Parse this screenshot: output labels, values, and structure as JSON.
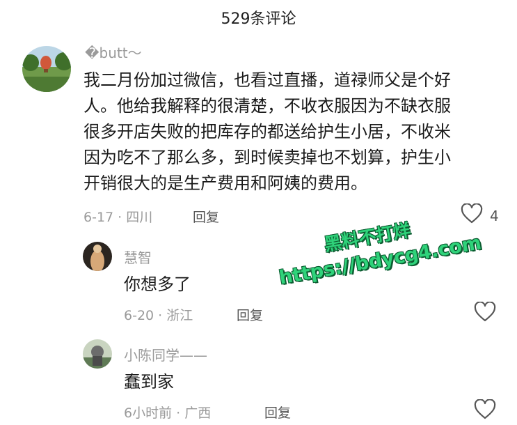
{
  "header": {
    "title": "529条评论"
  },
  "comments": [
    {
      "username": "�butt～",
      "lines": [
        "我二月份加过微信，也看过直播，道禄师父是个好",
        "人。他给我解释的很清楚，不收衣服因为不缺衣服",
        "很多开店失败的把库存的都送给护生小居，不收米",
        "因为吃不了那么多，到时候卖掉也不划算，护生小",
        "开销很大的是生产费用和阿姨的费用。"
      ],
      "meta": "6-17 · 四川",
      "reply_label": "回复",
      "likes": "4"
    }
  ],
  "replies": [
    {
      "username": "慧智",
      "text": "你想多了",
      "meta": "6-20 · 浙江",
      "reply_label": "回复"
    },
    {
      "username": "小陈同学——",
      "text": "蠢到家",
      "meta": "6小时前 · 广西",
      "reply_label": "回复"
    }
  ],
  "watermark": {
    "line1": "黑料不打烊",
    "line2": "https://bdycg4.com"
  }
}
